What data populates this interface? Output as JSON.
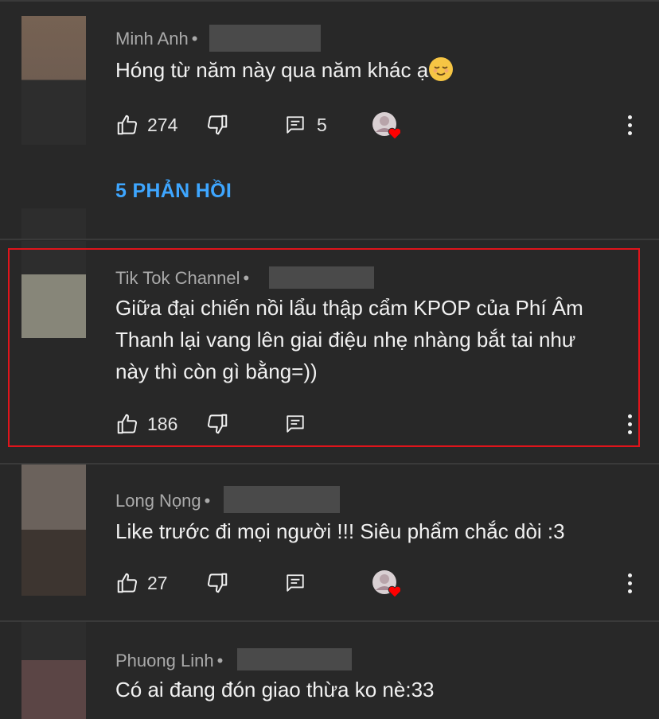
{
  "comments": [
    {
      "author": "Minh Anh",
      "text": "Hóng từ năm này qua năm khác ạ",
      "emoji": "relieved-face",
      "likes": "274",
      "replies_count": "5",
      "replies_link": "5 PHẢN HỒI",
      "creator_heart": true
    },
    {
      "author": "Tik Tok Channel",
      "text_lines": [
        "Giữa đại chiến  nồi lẩu thập cẩm KPOP của Phí Âm",
        "Thanh lại vang lên giai điệu nhẹ nhàng bắt tai như",
        "này thì còn gì bằng=))"
      ],
      "likes": "186",
      "highlighted": true
    },
    {
      "author": "Long Nọng",
      "text": "Like trước đi mọi người !!! Siêu phẩm chắc dòi :3",
      "likes": "27",
      "creator_heart": true
    },
    {
      "author": "Phuong Linh",
      "text": "Có ai đang đón giao thừa ko nè:33"
    }
  ],
  "separator": "•",
  "colors": {
    "background": "#282828",
    "link": "#3ea6ff",
    "highlight": "#e0141b",
    "heart": "#ff0000"
  },
  "icons": [
    "thumb-up-icon",
    "thumb-down-icon",
    "reply-icon",
    "more-vert-icon",
    "creator-heart-icon"
  ]
}
